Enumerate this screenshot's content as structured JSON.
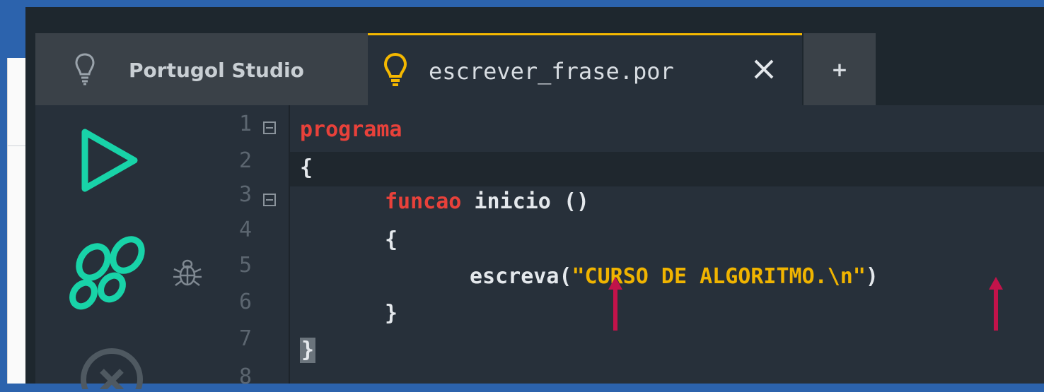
{
  "tabs": {
    "home": {
      "label": "Portugol Studio",
      "icon": "lightbulb-icon"
    },
    "file": {
      "label": "escrever_frase.por",
      "icon": "lightbulb-icon",
      "close_icon": "close-icon"
    },
    "add": {
      "label": "+"
    }
  },
  "toolbar": {
    "run_icon": "play-icon",
    "step_icon": "step-icon",
    "debug_icon": "bug-icon",
    "stop_icon": "stop-icon"
  },
  "editor": {
    "line_numbers": [
      "1",
      "2",
      "3",
      "4",
      "5",
      "6",
      "7",
      "8"
    ],
    "lines": {
      "l1_kw": "programa",
      "l2": "{",
      "l3_kw": "funcao",
      "l3_rest": " inicio ()",
      "l4": "{",
      "l5_fn": "escreva(",
      "l5_str": "\"CURSO DE ALGORITMO.\\n\"",
      "l5_close": ")",
      "l6": "}",
      "l7": "}"
    }
  },
  "annotations": {
    "arrow_color": "#c2134a",
    "arrows": 2
  },
  "colors": {
    "accent": "#f5b800",
    "run": "#18d3a8",
    "keyword": "#e8413a",
    "string": "#f0b400",
    "text": "#e4e8ec",
    "background": "#27303a"
  }
}
